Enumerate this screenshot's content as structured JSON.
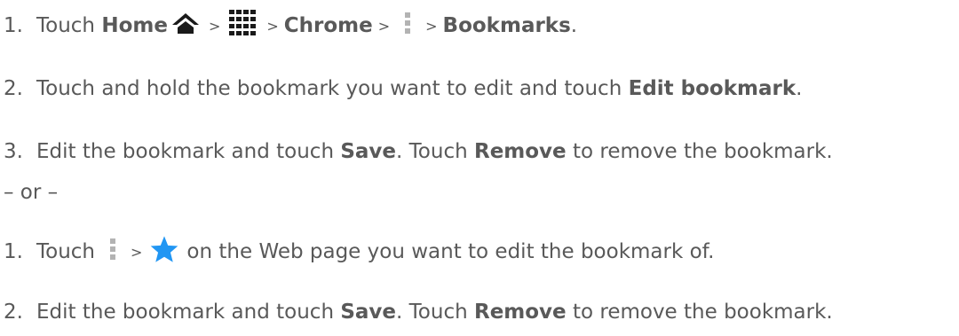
{
  "steps_a": [
    {
      "num": "1.",
      "touch": "Touch",
      "home": "Home",
      "gt": ">",
      "chrome": "Chrome",
      "bookmarks": "Bookmarks",
      "period": "."
    },
    {
      "num": "2.",
      "text1": "Touch and hold the bookmark you want to edit and touch",
      "edit_bookmark": "Edit bookmark",
      "period": "."
    },
    {
      "num": "3.",
      "text1": "Edit the bookmark and touch",
      "save": "Save",
      "text2": ". Touch",
      "remove": "Remove",
      "text3": "to remove the bookmark."
    }
  ],
  "or_text": "– or –",
  "steps_b": [
    {
      "num": "1.",
      "touch": "Touch",
      "gt": ">",
      "text1": "on the Web page you want to edit the bookmark of."
    },
    {
      "num": "2.",
      "text1": "Edit the bookmark and touch",
      "save": "Save",
      "text2": ". Touch",
      "remove": "Remove",
      "text3": "to remove the bookmark."
    }
  ],
  "icons": {
    "home": "home-icon",
    "apps": "apps-grid-icon",
    "menu": "menu-dots-icon",
    "star": "star-icon"
  },
  "colors": {
    "text": "#595959",
    "icon_dark": "#1a1a1a",
    "menu_icon": "#b3b3b3",
    "star": "#2196f3"
  }
}
